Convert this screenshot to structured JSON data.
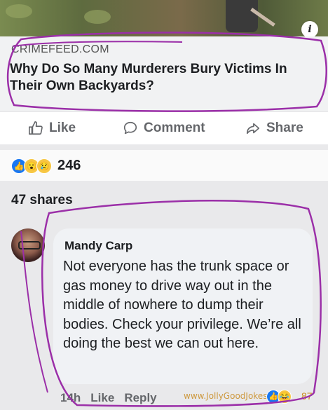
{
  "post": {
    "domain": "CRIMEFEED.COM",
    "headline": "Why Do So Many Murderers Bury Victims In Their Own Backyards?",
    "info_icon": "i"
  },
  "actions": {
    "like_label": "Like",
    "comment_label": "Comment",
    "share_label": "Share"
  },
  "reactions": {
    "count": "246",
    "types": [
      "like",
      "wow",
      "sad"
    ]
  },
  "shares": {
    "label": "47 shares"
  },
  "comment": {
    "author": "Mandy Carp",
    "text": "Not everyone has the trunk space or gas money to drive way out in the middle of nowhere to dump their bodies. Check your privilege. We’re all doing the best we can out here.",
    "time": "14h",
    "like_label": "Like",
    "reply_label": "Reply",
    "reaction_count": "87"
  },
  "watermark": {
    "text": "www.JollyGoodJokes.com"
  },
  "colors": {
    "annotation": "#9b2fa8",
    "like_blue": "#1877f2",
    "action_gray": "#65676b"
  }
}
